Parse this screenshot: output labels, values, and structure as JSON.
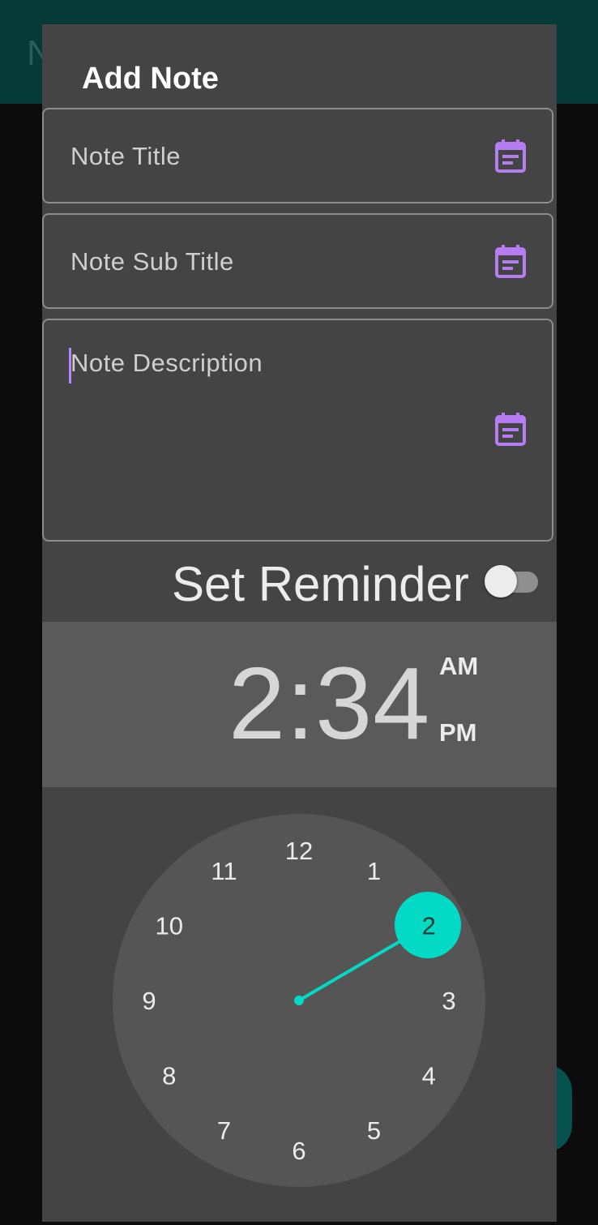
{
  "background_app": {
    "title_partial": "N",
    "bar_color": "#063a39"
  },
  "dialog": {
    "title": "Add Note",
    "fields": {
      "title_placeholder": "Note Title",
      "subtitle_placeholder": "Note Sub Title",
      "description_placeholder": "Note Description"
    },
    "field_icon": "calendar-note-icon",
    "reminder": {
      "label": "Set Reminder",
      "enabled": false
    },
    "time_picker": {
      "time": "2:34",
      "am_label": "AM",
      "pm_label": "PM",
      "selected_period": "PM",
      "selected_hour": 2,
      "hours": [
        "12",
        "1",
        "2",
        "3",
        "4",
        "5",
        "6",
        "7",
        "8",
        "9",
        "10",
        "11"
      ]
    }
  },
  "colors": {
    "accent": "#03dac5",
    "icon_purple": "#b67cf2",
    "cursor": "#b388ff"
  }
}
